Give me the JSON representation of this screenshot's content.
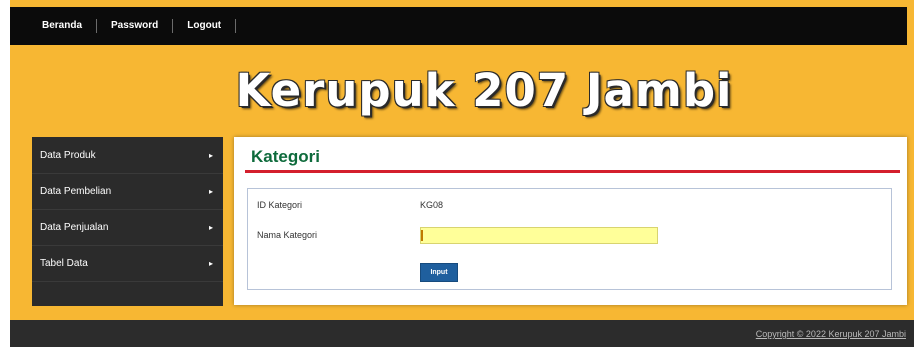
{
  "nav": {
    "items": [
      "Beranda",
      "Password",
      "Logout"
    ]
  },
  "banner": {
    "title": "Kerupuk 207 Jambi"
  },
  "sidebar": {
    "items": [
      {
        "label": "Data Produk"
      },
      {
        "label": "Data Pembelian"
      },
      {
        "label": "Data Penjualan"
      },
      {
        "label": "Tabel Data"
      }
    ],
    "arrow": "▸"
  },
  "panel": {
    "title": "Kategori",
    "id_label": "ID Kategori",
    "id_value": "KG08",
    "name_label": "Nama Kategori",
    "name_value": "",
    "submit_label": "Input"
  },
  "footer": {
    "copyright": "Copyright © 2022 Kerupuk 207 Jambi"
  },
  "colors": {
    "background": "#f7b733",
    "nav": "#0b0b0b",
    "title_green": "#0e6b3c",
    "rule_red": "#d41f2d",
    "button_blue": "#1f5f9e",
    "input_yellow": "#ffff99"
  }
}
